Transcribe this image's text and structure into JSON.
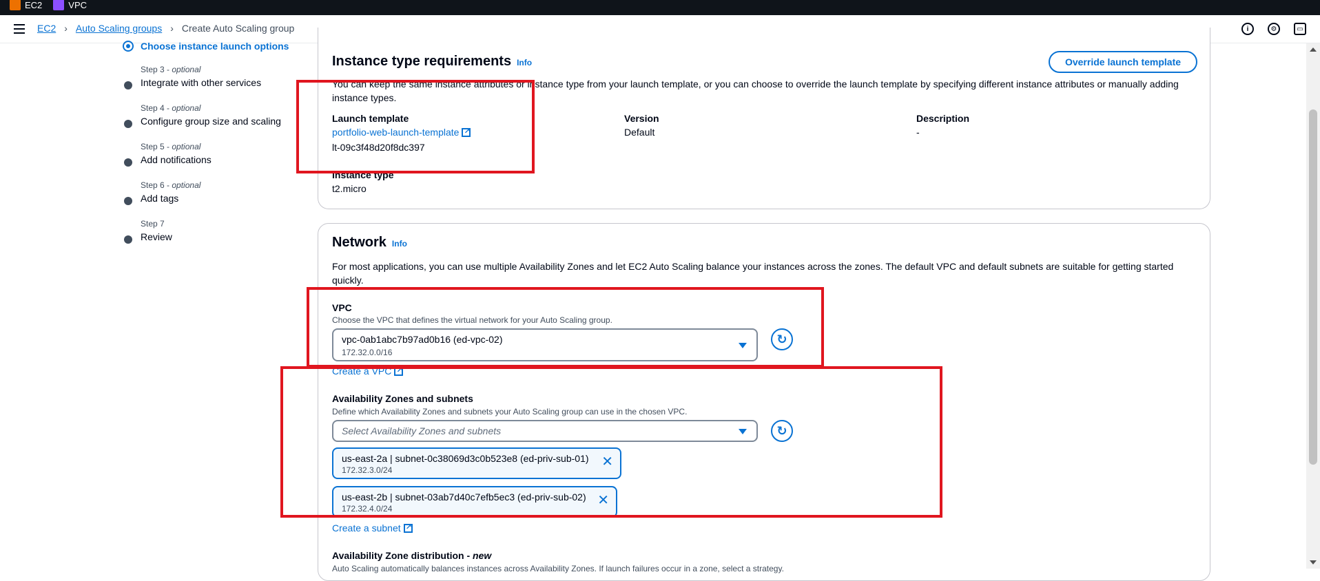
{
  "topbar": {
    "services": [
      {
        "label": "EC2",
        "icon": "ec2-service-icon",
        "color": "#ed7100"
      },
      {
        "label": "VPC",
        "icon": "vpc-service-icon",
        "color": "#8c4fff"
      }
    ]
  },
  "breadcrumb": {
    "items": [
      "EC2",
      "Auto Scaling groups"
    ],
    "current": "Create Auto Scaling group"
  },
  "steps": {
    "active": "Choose instance launch options",
    "list": [
      {
        "label": "Step 3",
        "optional": "optional",
        "title": "Integrate with other services"
      },
      {
        "label": "Step 4",
        "optional": "optional",
        "title": "Configure group size and scaling"
      },
      {
        "label": "Step 5",
        "optional": "optional",
        "title": "Add notifications"
      },
      {
        "label": "Step 6",
        "optional": "optional",
        "title": "Add tags"
      },
      {
        "label": "Step 7",
        "optional": "",
        "title": "Review"
      }
    ]
  },
  "instance_type": {
    "title": "Instance type requirements",
    "info": "Info",
    "override_button": "Override launch template",
    "description": "You can keep the same instance attributes or instance type from your launch template, or you can choose to override the launch template by specifying different instance attributes or manually adding instance types.",
    "launch_template_label": "Launch template",
    "launch_template_link": "portfolio-web-launch-template",
    "launch_template_id": "lt-09c3f48d20f8dc397",
    "version_label": "Version",
    "version_value": "Default",
    "description_label": "Description",
    "description_value": "-",
    "instance_type_label": "Instance type",
    "instance_type_value": "t2.micro"
  },
  "network": {
    "title": "Network",
    "info": "Info",
    "description": "For most applications, you can use multiple Availability Zones and let EC2 Auto Scaling balance your instances across the zones. The default VPC and default subnets are suitable for getting started quickly.",
    "vpc_label": "VPC",
    "vpc_desc": "Choose the VPC that defines the virtual network for your Auto Scaling group.",
    "vpc_value": "vpc-0ab1abc7b97ad0b16 (ed-vpc-02)",
    "vpc_cidr": "172.32.0.0/16",
    "create_vpc": "Create a VPC",
    "az_label": "Availability Zones and subnets",
    "az_desc": "Define which Availability Zones and subnets your Auto Scaling group can use in the chosen VPC.",
    "az_placeholder": "Select Availability Zones and subnets",
    "subnets": [
      {
        "name": "us-east-2a | subnet-0c38069d3c0b523e8 (ed-priv-sub-01)",
        "cidr": "172.32.3.0/24"
      },
      {
        "name": "us-east-2b | subnet-03ab7d40c7efb5ec3 (ed-priv-sub-02)",
        "cidr": "172.32.4.0/24"
      }
    ],
    "create_subnet": "Create a subnet",
    "az_distribution_label": "Availability Zone distribution - ",
    "az_distribution_new": "new",
    "az_distribution_desc": "Auto Scaling automatically balances instances across Availability Zones. If launch failures occur in a zone, select a strategy."
  },
  "accent_color": "#0972d3",
  "highlight_color": "#e0161f"
}
